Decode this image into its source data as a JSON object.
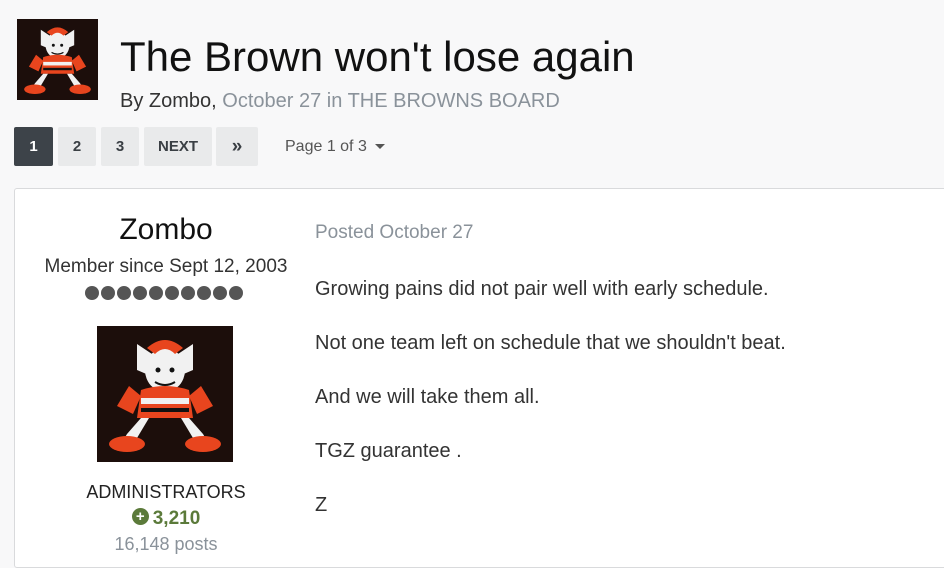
{
  "topic": {
    "title": "The Brown won't lose again",
    "by_prefix": "By",
    "author": "Zombo",
    "date": "October 27",
    "in_word": "in",
    "forum": "THE BROWNS BOARD"
  },
  "pagination": {
    "pages": [
      "1",
      "2",
      "3"
    ],
    "active": "1",
    "next_label": "NEXT",
    "last_icon": "double-chevron-right-icon",
    "last_glyph": "»",
    "page_of": "Page 1 of 3",
    "caret_icon": "caret-down-icon"
  },
  "post": {
    "author": {
      "name": "Zombo",
      "member_since": "Member since Sept 12, 2003",
      "rank_pips": 10,
      "group": "ADMINISTRATORS",
      "reputation_icon": "plus-circle-icon",
      "reputation_glyph": "+",
      "reputation": "3,210",
      "posts": "16,148 posts",
      "avatar_icon": "browns-elf-logo-icon"
    },
    "posted": "Posted October 27",
    "body": [
      "Growing pains did not pair well with early schedule.",
      "Not one team left on schedule that we shouldn't beat.",
      "And we will take them all.",
      "TGZ guarantee .",
      "Z"
    ]
  },
  "colors": {
    "background": "#f8f8f9",
    "muted_text": "#8a929a",
    "active_page_bg": "#3d4349",
    "page_button_bg": "#e9eaeb",
    "reputation_green": "#5b7a3a",
    "browns_orange": "#e8451e"
  }
}
